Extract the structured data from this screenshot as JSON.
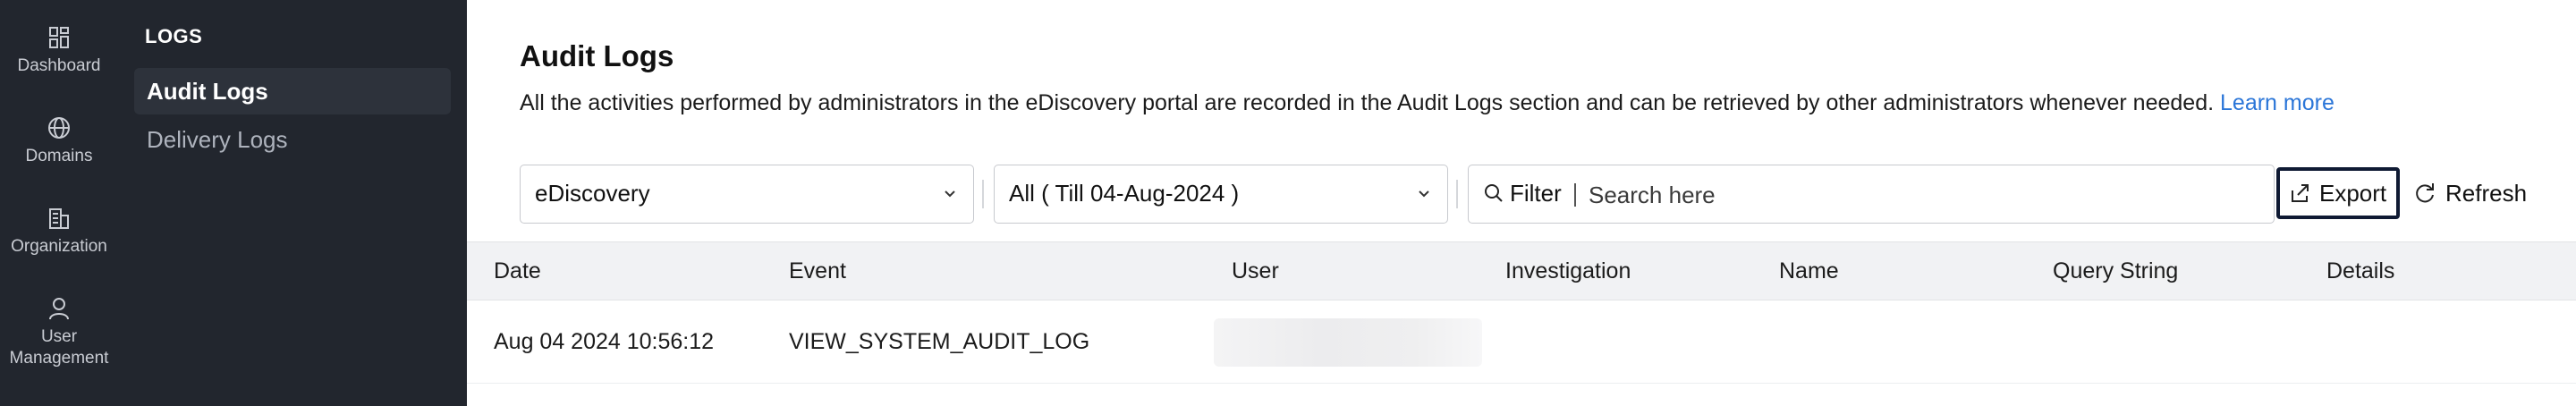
{
  "rail": {
    "items": [
      {
        "label": "Dashboard",
        "icon": "grid-icon"
      },
      {
        "label": "Domains",
        "icon": "globe-icon"
      },
      {
        "label": "Organization",
        "icon": "building-icon"
      },
      {
        "label_lines": [
          "User",
          "Management"
        ],
        "icon": "user-icon"
      }
    ]
  },
  "subnav": {
    "heading": "LOGS",
    "items": [
      {
        "label": "Audit Logs",
        "active": true
      },
      {
        "label": "Delivery Logs",
        "active": false
      }
    ]
  },
  "main": {
    "title": "Audit Logs",
    "description": "All the activities performed by administrators in the eDiscovery portal are recorded in the Audit Logs section and can be retrieved by other administrators whenever needed.",
    "learn_more": "Learn more"
  },
  "toolbar": {
    "module_select": "eDiscovery",
    "period_select": "All ( Till 04-Aug-2024 )",
    "filter_label": "Filter",
    "search_placeholder": "Search here",
    "export_label": "Export",
    "refresh_label": "Refresh"
  },
  "table": {
    "columns": [
      "Date",
      "Event",
      "User",
      "Investigation",
      "Name",
      "Query String",
      "Details"
    ],
    "rows": [
      {
        "date": "Aug 04 2024 10:56:12",
        "event": "VIEW_SYSTEM_AUDIT_LOG",
        "user": "",
        "investigation": "",
        "name": "",
        "query_string": "",
        "details": ""
      }
    ]
  },
  "colors": {
    "sidebar_bg": "#22262e",
    "active_item_bg": "#2d323b",
    "link": "#2b76d8",
    "export_border": "#0f1a33",
    "header_bg": "#f1f2f4"
  }
}
